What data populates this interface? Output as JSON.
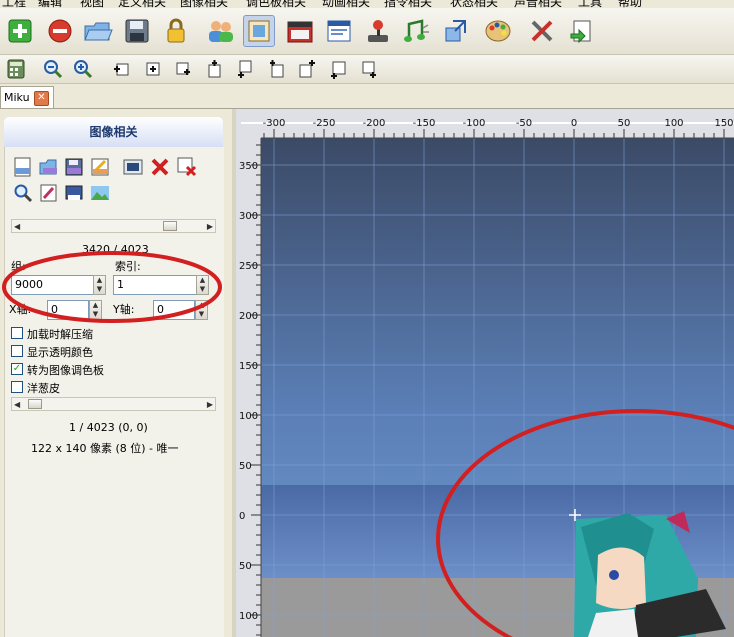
{
  "menu": [
    "工程",
    "编辑",
    "视图",
    "定义相关",
    "图像相关",
    "调色板相关",
    "动画相关",
    "指令相关",
    "状态相关",
    "声音相关",
    "工具",
    "帮助"
  ],
  "toolbar": {
    "buttons": [
      "new-project-icon",
      "delete-icon",
      "open-folder-icon",
      "save-icon",
      "lock-icon",
      "users-icon",
      "image-icon",
      "film-icon",
      "window-icon",
      "joystick-icon",
      "music-icon",
      "import-icon",
      "palette-icon",
      "tools-icon",
      "dependency-icon"
    ],
    "secondary": [
      "calculator-icon",
      "zoom-out-icon",
      "zoom-in-icon",
      "align-tl-icon",
      "align-center-icon",
      "align-br-icon",
      "align-t-icon",
      "align-b-icon",
      "align-tr-icon",
      "align-r-icon",
      "align-l-icon",
      "align-bl-icon"
    ]
  },
  "tab": {
    "label": "Miku"
  },
  "panel": {
    "title": "图像相关",
    "file_icons": [
      "pcx-new-icon",
      "pcx-open-icon",
      "pcx-save-icon",
      "sff-edit-icon",
      "image-view-icon",
      "delete-red-icon",
      "delete-image-icon",
      "search-icon",
      "edit-sprite-icon",
      "abc-text-icon",
      "landscape-icon"
    ],
    "count_text": "3420 / 4023",
    "group_label": "组:",
    "group_value": "9000",
    "index_label": "索引:",
    "index_value": "1",
    "x_label": "X轴:",
    "x_value": "0",
    "y_label": "Y轴:",
    "y_value": "0",
    "checkboxes": [
      {
        "label": "加载时解压缩",
        "checked": false
      },
      {
        "label": "显示透明颜色",
        "checked": false
      },
      {
        "label": "转为图像调色板",
        "checked": true
      },
      {
        "label": "洋葱皮",
        "checked": false
      }
    ],
    "status_line1": "1 / 4023 (0, 0)",
    "status_line2": "122 x 140 像素 (8 位) - 唯一"
  },
  "canvas": {
    "x_ticks": [
      "-300",
      "-250",
      "-200",
      "-150",
      "-100",
      "-50",
      "0",
      "50",
      "100",
      "150"
    ],
    "y_ticks": [
      "350",
      "300",
      "250",
      "200",
      "150",
      "100",
      "50",
      "0",
      "50",
      "100"
    ]
  }
}
